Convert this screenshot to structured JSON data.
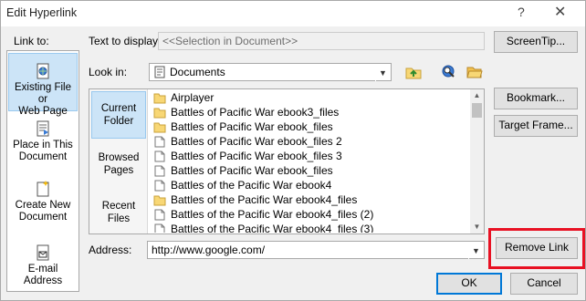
{
  "window": {
    "title": "Edit Hyperlink",
    "help_glyph": "?",
    "close_glyph": "✕"
  },
  "link_to": {
    "label": "Link to:",
    "items": [
      {
        "line1": "Existing File or",
        "line2": "Web Page",
        "icon": "web-page-icon",
        "selected": true
      },
      {
        "line1": "Place in This",
        "line2": "Document",
        "icon": "place-in-document-icon",
        "selected": false
      },
      {
        "line1": "Create New",
        "line2": "Document",
        "icon": "new-document-icon",
        "selected": false
      },
      {
        "line1": "E-mail Address",
        "line2": "",
        "icon": "email-icon",
        "selected": false
      }
    ]
  },
  "text_to_display": {
    "label": "Text to display:",
    "value": "<<Selection in Document>>"
  },
  "screentip_button": "ScreenTip...",
  "look_in": {
    "label": "Look in:",
    "value": "Documents"
  },
  "side_buttons": {
    "bookmark": "Bookmark...",
    "target_frame": "Target Frame..."
  },
  "nav": {
    "current_folder": {
      "line1": "Current",
      "line2": "Folder"
    },
    "browsed_pages": {
      "line1": "Browsed",
      "line2": "Pages"
    },
    "recent_files": {
      "line1": "Recent",
      "line2": "Files"
    }
  },
  "files": [
    {
      "name": "Airplayer",
      "type": "folder"
    },
    {
      "name": "Battles of Pacific War ebook3_files",
      "type": "folder"
    },
    {
      "name": "Battles of Pacific War ebook_files",
      "type": "folder"
    },
    {
      "name": "Battles of Pacific War ebook_files 2",
      "type": "file"
    },
    {
      "name": "Battles of Pacific War ebook_files 3",
      "type": "file"
    },
    {
      "name": "Battles of Pacific War ebook_files",
      "type": "file"
    },
    {
      "name": "Battles of the Pacific War ebook4",
      "type": "file"
    },
    {
      "name": "Battles of the Pacific War ebook4_files",
      "type": "folder"
    },
    {
      "name": "Battles of the Pacific War ebook4_files (2)",
      "type": "file"
    },
    {
      "name": "Battles of the Pacific War ebook4_files (3)",
      "type": "file"
    }
  ],
  "address": {
    "label": "Address:",
    "value": "http://www.google.com/"
  },
  "remove_link_button": "Remove Link",
  "ok_button": "OK",
  "cancel_button": "Cancel",
  "colors": {
    "highlight": "#e81123",
    "selection": "#cce4f7",
    "folder": "#f8d775"
  }
}
